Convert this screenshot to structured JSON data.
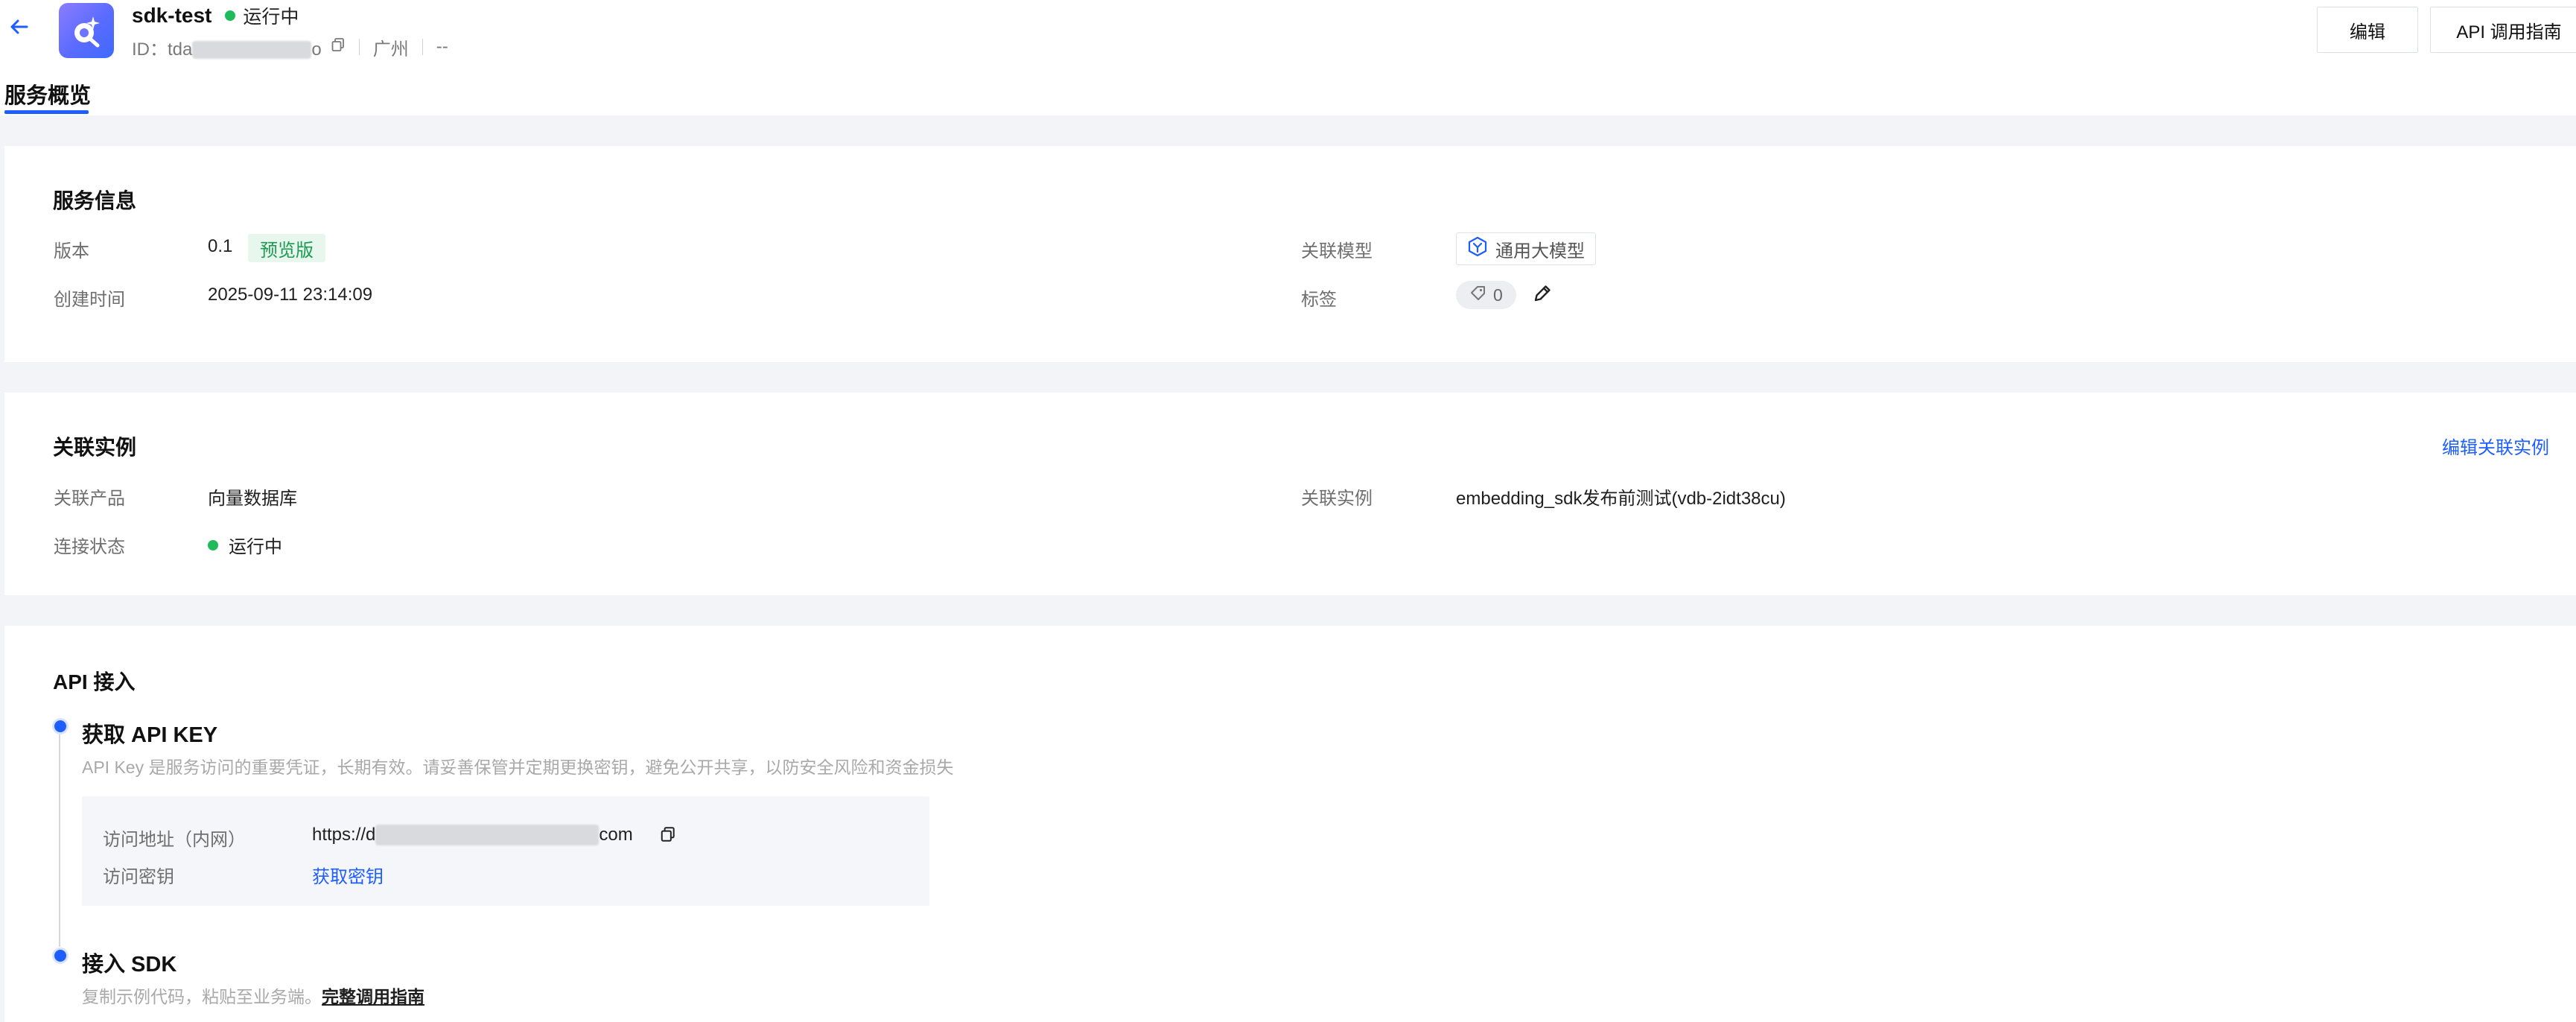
{
  "header": {
    "service_name": "sdk-test",
    "status": "运行中",
    "id_label": "ID：",
    "id_prefix": "tda",
    "id_suffix": "o",
    "region": "广州",
    "extra": "--",
    "edit_button": "编辑",
    "api_guide_button": "API 调用指南"
  },
  "tabs": [
    {
      "label": "服务概览",
      "active": true
    }
  ],
  "service_info": {
    "title": "服务信息",
    "version_label": "版本",
    "version_value": "0.1",
    "version_badge": "预览版",
    "created_label": "创建时间",
    "created_value": "2025-09-11 23:14:09",
    "model_label": "关联模型",
    "model_value": "通用大模型",
    "tags_label": "标签",
    "tags_count": "0"
  },
  "linked_instance": {
    "title": "关联实例",
    "edit_link": "编辑关联实例",
    "product_label": "关联产品",
    "product_value": "向量数据库",
    "conn_label": "连接状态",
    "conn_value": "运行中",
    "instance_label": "关联实例",
    "instance_value": "embedding_sdk发布前测试(vdb-2idt38cu)"
  },
  "api_access": {
    "title": "API 接入",
    "step1_title": "获取 API KEY",
    "step1_desc": "API Key 是服务访问的重要凭证，长期有效。请妥善保管并定期更换密钥，避免公开共享，以防安全风险和资金损失",
    "addr_label": "访问地址（内网）",
    "addr_prefix": "https://d",
    "addr_suffix": "com",
    "key_label": "访问密钥",
    "key_link": "获取密钥",
    "step2_title": "接入 SDK",
    "step2_desc": "复制示例代码，粘贴至业务端。",
    "step2_link": "完整调用指南"
  },
  "colors": {
    "accent": "#1e5eff",
    "success": "#1fbb5a",
    "badge_bg": "#e8f7ee",
    "badge_fg": "#1d9a51"
  }
}
